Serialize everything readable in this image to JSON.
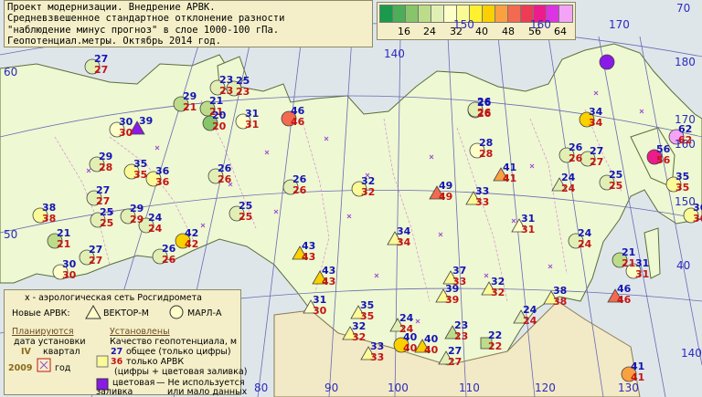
{
  "header": {
    "line1": "Проект модернизации. Внедрение АРВК.",
    "line2": "Средневзвешенное стандартное отклонение разности",
    "line3": "\"наблюдение минус прогноз\" в слое 1000-100 гПа.",
    "line4": "Геопотенциал.метры. Октябрь 2014 год."
  },
  "scale": {
    "colors": [
      "#1a9a4c",
      "#4cae58",
      "#86c56a",
      "#bcdc8a",
      "#e2efb4",
      "#fefec8",
      "#fafa96",
      "#fff030",
      "#fbd000",
      "#fba040",
      "#f26a50",
      "#ee3c54",
      "#ec1c8c",
      "#dc34e2",
      "#f4a4f6"
    ],
    "labels": [
      "16",
      "24",
      "32",
      "40",
      "48",
      "56",
      "64"
    ]
  },
  "lat_labels": [
    "70",
    "60",
    "50",
    "40"
  ],
  "lon_labels": [
    "80",
    "90",
    "100",
    "110",
    "120",
    "130",
    "140",
    "150",
    "160",
    "170",
    "180",
    "170",
    "160",
    "150",
    "140"
  ],
  "stations": [
    {
      "blue": "27",
      "red": "27",
      "fill": "#e2efb4",
      "shape": "c"
    },
    {
      "blue": "29",
      "red": "21",
      "fill": "#bcdc8a",
      "shape": "c"
    },
    {
      "blue": "23",
      "red": "23",
      "fill": "#e2efb4",
      "shape": "c"
    },
    {
      "blue": "25",
      "red": "23",
      "fill": "#e2efb4",
      "shape": "c"
    },
    {
      "blue": "21",
      "red": "21",
      "fill": "#bcdc8a",
      "shape": "c"
    },
    {
      "blue": "20",
      "red": "20",
      "fill": "#86c56a",
      "shape": "c"
    },
    {
      "blue": "31",
      "red": "31",
      "fill": "#fefec8",
      "shape": "c"
    },
    {
      "blue": "46",
      "red": "46",
      "fill": "#f26a50",
      "shape": "c"
    },
    {
      "blue": "26",
      "red": "26",
      "fill": "#e2efb4",
      "shape": "c"
    },
    {
      "blue": "39",
      "red": "",
      "fill": "#8a1ae6",
      "shape": "t"
    },
    {
      "blue": "30",
      "red": "30",
      "fill": "#fefec8",
      "shape": "c"
    },
    {
      "blue": "29",
      "red": "28",
      "fill": "#e2efb4",
      "shape": "c"
    },
    {
      "blue": "35",
      "red": "35",
      "fill": "#fafa96",
      "shape": "c"
    },
    {
      "blue": "36",
      "red": "36",
      "fill": "#fafa96",
      "shape": "c"
    },
    {
      "blue": "26",
      "red": "26",
      "fill": "#e2efb4",
      "shape": "c"
    },
    {
      "blue": "26",
      "red": "26",
      "fill": "#e2efb4",
      "shape": "c"
    },
    {
      "blue": "27",
      "red": "27",
      "fill": "#e2efb4",
      "shape": "c"
    },
    {
      "blue": "38",
      "red": "38",
      "fill": "#fafa96",
      "shape": "c"
    },
    {
      "blue": "25",
      "red": "25",
      "fill": "#e2efb4",
      "shape": "c"
    },
    {
      "blue": "29",
      "red": "29",
      "fill": "#e2efb4",
      "shape": "c"
    },
    {
      "blue": "24",
      "red": "24",
      "fill": "#e2efb4",
      "shape": "c"
    },
    {
      "blue": "25",
      "red": "25",
      "fill": "#e2efb4",
      "shape": "c"
    },
    {
      "blue": "21",
      "red": "21",
      "fill": "#bcdc8a",
      "shape": "c"
    },
    {
      "blue": "42",
      "red": "42",
      "fill": "#fbd000",
      "shape": "c"
    },
    {
      "blue": "26",
      "red": "26",
      "fill": "#e2efb4",
      "shape": "c"
    },
    {
      "blue": "27",
      "red": "27",
      "fill": "#e2efb4",
      "shape": "c"
    },
    {
      "blue": "30",
      "red": "30",
      "fill": "#fefec8",
      "shape": "c"
    },
    {
      "blue": "43",
      "red": "43",
      "fill": "#fbd000",
      "shape": "t"
    },
    {
      "blue": "43",
      "red": "43",
      "fill": "#fbd000",
      "shape": "t"
    },
    {
      "blue": "31",
      "red": "30",
      "fill": "#fefec8",
      "shape": "t"
    },
    {
      "blue": "32",
      "red": "32",
      "fill": "#fafa96",
      "shape": "c"
    },
    {
      "blue": "26",
      "red": "26",
      "fill": "#e2efb4",
      "shape": "c"
    },
    {
      "blue": "34",
      "red": "34",
      "fill": "#fafa96",
      "shape": "t"
    },
    {
      "blue": "49",
      "red": "49",
      "fill": "#f26a50",
      "shape": "t"
    },
    {
      "blue": "33",
      "red": "33",
      "fill": "#fafa96",
      "shape": "t"
    },
    {
      "blue": "41",
      "red": "41",
      "fill": "#fba040",
      "shape": "t"
    },
    {
      "blue": "28",
      "red": "28",
      "fill": "#fefec8",
      "shape": "c"
    },
    {
      "blue": "26",
      "red": "26",
      "fill": "#e2efb4",
      "shape": "c"
    },
    {
      "blue": "31",
      "red": "31",
      "fill": "#fefec8",
      "shape": "t"
    },
    {
      "blue": "24",
      "red": "24",
      "fill": "#e2efb4",
      "shape": "t"
    },
    {
      "blue": "27",
      "red": "27",
      "fill": "#e2efb4",
      "shape": "c"
    },
    {
      "blue": "34",
      "red": "34",
      "fill": "#fbd000",
      "shape": "c"
    },
    {
      "blue": "25",
      "red": "25",
      "fill": "#e2efb4",
      "shape": "c"
    },
    {
      "blue": "35",
      "red": "35",
      "fill": "#fafa96",
      "shape": "c"
    },
    {
      "blue": "56",
      "red": "56",
      "fill": "#ec1c8c",
      "shape": "c"
    },
    {
      "blue": "62",
      "red": "62",
      "fill": "#f4a4f6",
      "shape": "c"
    },
    {
      "blue": "36",
      "red": "36",
      "fill": "#fafa96",
      "shape": "c"
    },
    {
      "blue": "24",
      "red": "24",
      "fill": "#e2efb4",
      "shape": "c"
    },
    {
      "blue": "21",
      "red": "21",
      "fill": "#bcdc8a",
      "shape": "c"
    },
    {
      "blue": "31",
      "red": "31",
      "fill": "#fefec8",
      "shape": "c"
    },
    {
      "blue": "37",
      "red": "33",
      "fill": "#fafa96",
      "shape": "t"
    },
    {
      "blue": "39",
      "red": "39",
      "fill": "#fafa96",
      "shape": "t"
    },
    {
      "blue": "32",
      "red": "32",
      "fill": "#fafa96",
      "shape": "t"
    },
    {
      "blue": "38",
      "red": "38",
      "fill": "#fafa96",
      "shape": "t"
    },
    {
      "blue": "46",
      "red": "46",
      "fill": "#f26a50",
      "shape": "t"
    },
    {
      "blue": "35",
      "red": "35",
      "fill": "#fafa96",
      "shape": "t"
    },
    {
      "blue": "32",
      "red": "32",
      "fill": "#fafa96",
      "shape": "t"
    },
    {
      "blue": "24",
      "red": "24",
      "fill": "#e2efb4",
      "shape": "t"
    },
    {
      "blue": "23",
      "red": "23",
      "fill": "#bcdc8a",
      "shape": "t"
    },
    {
      "blue": "22",
      "red": "22",
      "fill": "#bcdc8a",
      "shape": "s"
    },
    {
      "blue": "24",
      "red": "24",
      "fill": "#e2efb4",
      "shape": "t"
    },
    {
      "blue": "33",
      "red": "33",
      "fill": "#fafa96",
      "shape": "t"
    },
    {
      "blue": "40",
      "red": "40",
      "fill": "#fbd000",
      "shape": "t"
    },
    {
      "blue": "27",
      "red": "27",
      "fill": "#e2efb4",
      "shape": "t"
    },
    {
      "blue": "40",
      "red": "40",
      "fill": "#fbd000",
      "shape": "c"
    },
    {
      "blue": "41",
      "red": "41",
      "fill": "#fba040",
      "shape": "c"
    },
    {
      "blue": "",
      "red": "",
      "fill": "#8a1ae6",
      "shape": "c"
    }
  ],
  "legend": {
    "title": "x - аэрологическая сеть Росгидромета",
    "new_arvk": "Новые АРВК:",
    "vektor": "ВЕКТОР-М",
    "marl": "МАРЛ-А",
    "planned": "Планируются",
    "date_install": "дата установки",
    "quarter": "квартал",
    "quarter_num": "IV",
    "year_num": "2009",
    "year_word": "год",
    "installed": "Установлены",
    "quality": "Качество геопотенциала, м",
    "ex_blue": "27",
    "ex_red": "36",
    "common": "общее (только цифры)",
    "only_arvk": "только АРВК",
    "digits_fill": "(цифры + цветовая заливка)",
    "color_fill": "цветовая",
    "fill_word": "заливка",
    "not_used1": "— Не используется",
    "not_used2": "или мало данных"
  }
}
